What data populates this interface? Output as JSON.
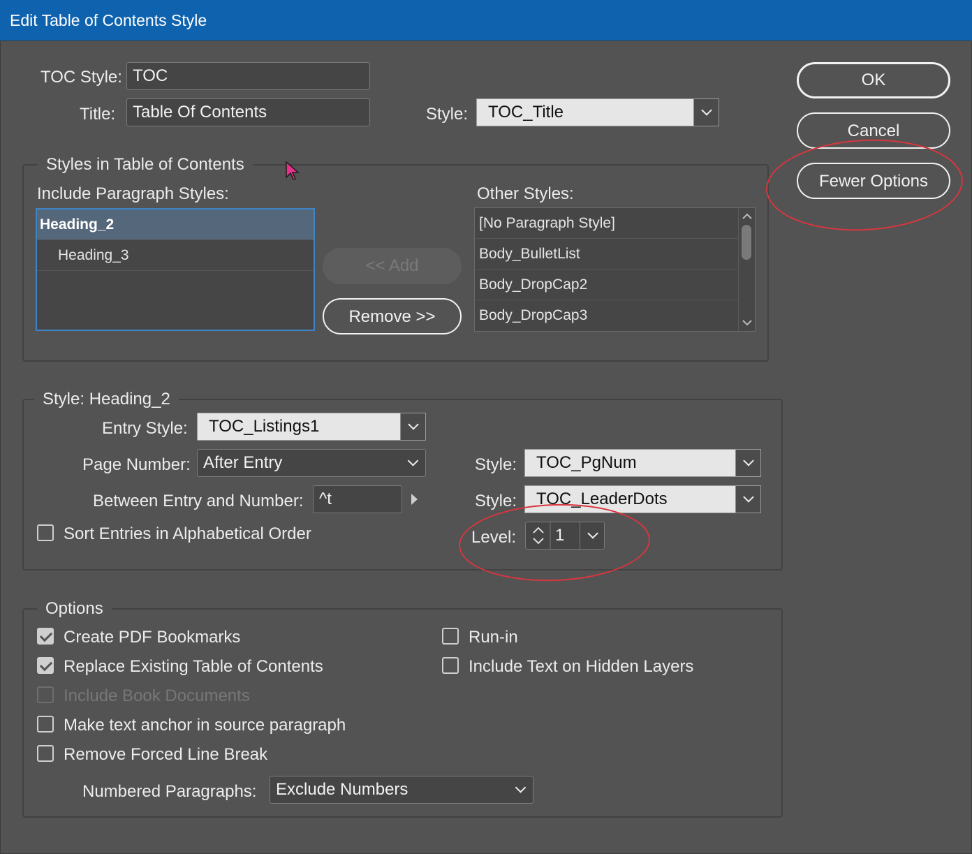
{
  "window": {
    "title": "Edit Table of Contents Style"
  },
  "top": {
    "toc_style_label": "TOC Style:",
    "toc_style_value": "TOC",
    "title_label": "Title:",
    "title_value": "Table Of Contents",
    "style_label": "Style:",
    "style_value": "TOC_Title"
  },
  "buttons": {
    "ok": "OK",
    "cancel": "Cancel",
    "fewer_options": "Fewer Options",
    "add": "<< Add",
    "remove": "Remove >>"
  },
  "styles_group": {
    "title": "Styles in Table of Contents",
    "include_label": "Include Paragraph Styles:",
    "include_items": [
      {
        "label": "Heading_2",
        "selected": true
      },
      {
        "label": "Heading_3",
        "selected": false
      }
    ],
    "other_label": "Other Styles:",
    "other_items": [
      "[No Paragraph Style]",
      "Body_BulletList",
      "Body_DropCap2",
      "Body_DropCap3"
    ]
  },
  "style_group": {
    "title": "Style: Heading_2",
    "entry_style_label": "Entry Style:",
    "entry_style_value": "TOC_Listings1",
    "page_number_label": "Page Number:",
    "page_number_value": "After Entry",
    "pn_style_label": "Style:",
    "pn_style_value": "TOC_PgNum",
    "between_label": "Between Entry and Number:",
    "between_value": "^t",
    "between_style_label": "Style:",
    "between_style_value": "TOC_LeaderDots",
    "sort_label": "Sort Entries in Alphabetical Order",
    "sort_checked": false,
    "level_label": "Level:",
    "level_value": "1"
  },
  "options_group": {
    "title": "Options",
    "create_pdf_bookmarks": {
      "label": "Create PDF Bookmarks",
      "checked": true
    },
    "replace_existing": {
      "label": "Replace Existing Table of Contents",
      "checked": true
    },
    "include_book": {
      "label": "Include Book Documents",
      "checked": false,
      "disabled": true
    },
    "make_anchor": {
      "label": "Make text anchor in source paragraph",
      "checked": false
    },
    "remove_forced": {
      "label": "Remove Forced Line Break",
      "checked": false
    },
    "run_in": {
      "label": "Run-in",
      "checked": false
    },
    "include_hidden": {
      "label": "Include Text on Hidden Layers",
      "checked": false
    },
    "numbered_label": "Numbered Paragraphs:",
    "numbered_value": "Exclude Numbers"
  },
  "colors": {
    "titlebar": "#0f63ae",
    "background": "#535353",
    "selection": "#55677a",
    "annotation": "#d9363e",
    "cursor": "#e8308c"
  }
}
